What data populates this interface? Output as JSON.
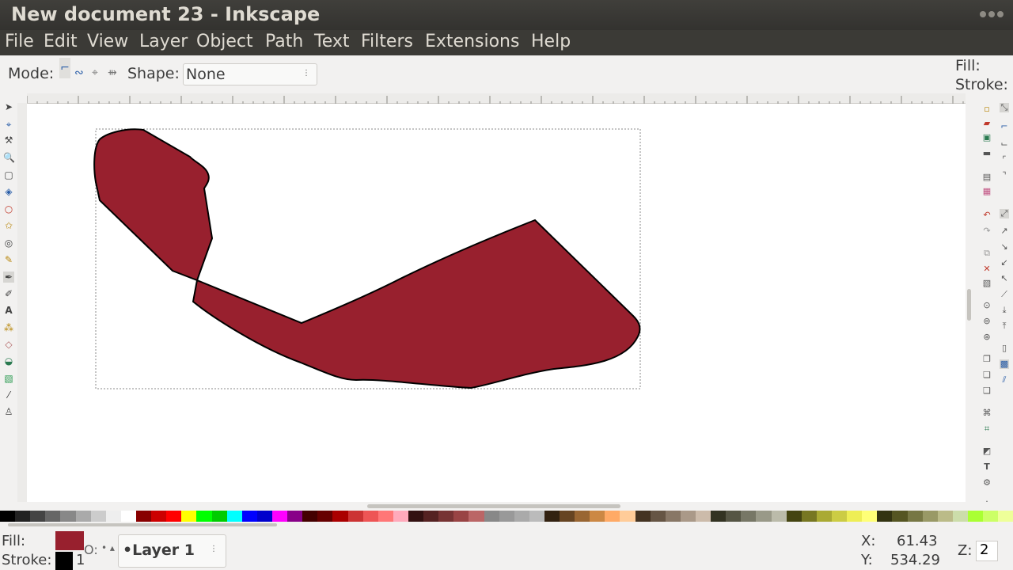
{
  "window": {
    "title": "New document 23 - Inkscape"
  },
  "menu": [
    "File",
    "Edit",
    "View",
    "Layer",
    "Object",
    "Path",
    "Text",
    "Filters",
    "Extensions",
    "Help"
  ],
  "toolbar": {
    "mode_label": "Mode:",
    "shape_label": "Shape:",
    "shape_value": "None",
    "fill_label": "Fill:",
    "stroke_label": "Stroke:"
  },
  "status": {
    "fill_label": "Fill:",
    "stroke_label": "Stroke:",
    "stroke_width": "1",
    "opacity_label": "O:",
    "layer_value": "•Layer 1",
    "x_label": "X:",
    "x_value": "61.43",
    "y_label": "Y:",
    "y_value": "534.29",
    "z_label": "Z:",
    "z_value": "2"
  },
  "colors": {
    "shape_fill": "#98202e",
    "stroke": "#000000",
    "titlebar": "#3b3a36"
  },
  "icons": {
    "tools": [
      "selector-icon",
      "node-tool-icon",
      "tweak-tool-icon",
      "zoom-icon",
      "rect-tool-icon",
      "3dbox-tool-icon",
      "ellipse-tool-icon",
      "star-tool-icon",
      "spiral-tool-icon",
      "pencil-tool-icon",
      "pen-tool-icon",
      "calligraphy-tool-icon",
      "text-tool-icon",
      "spray-tool-icon",
      "eraser-tool-icon",
      "bucket-tool-icon",
      "gradient-tool-icon",
      "dropper-tool-icon",
      "connector-tool-icon"
    ]
  }
}
